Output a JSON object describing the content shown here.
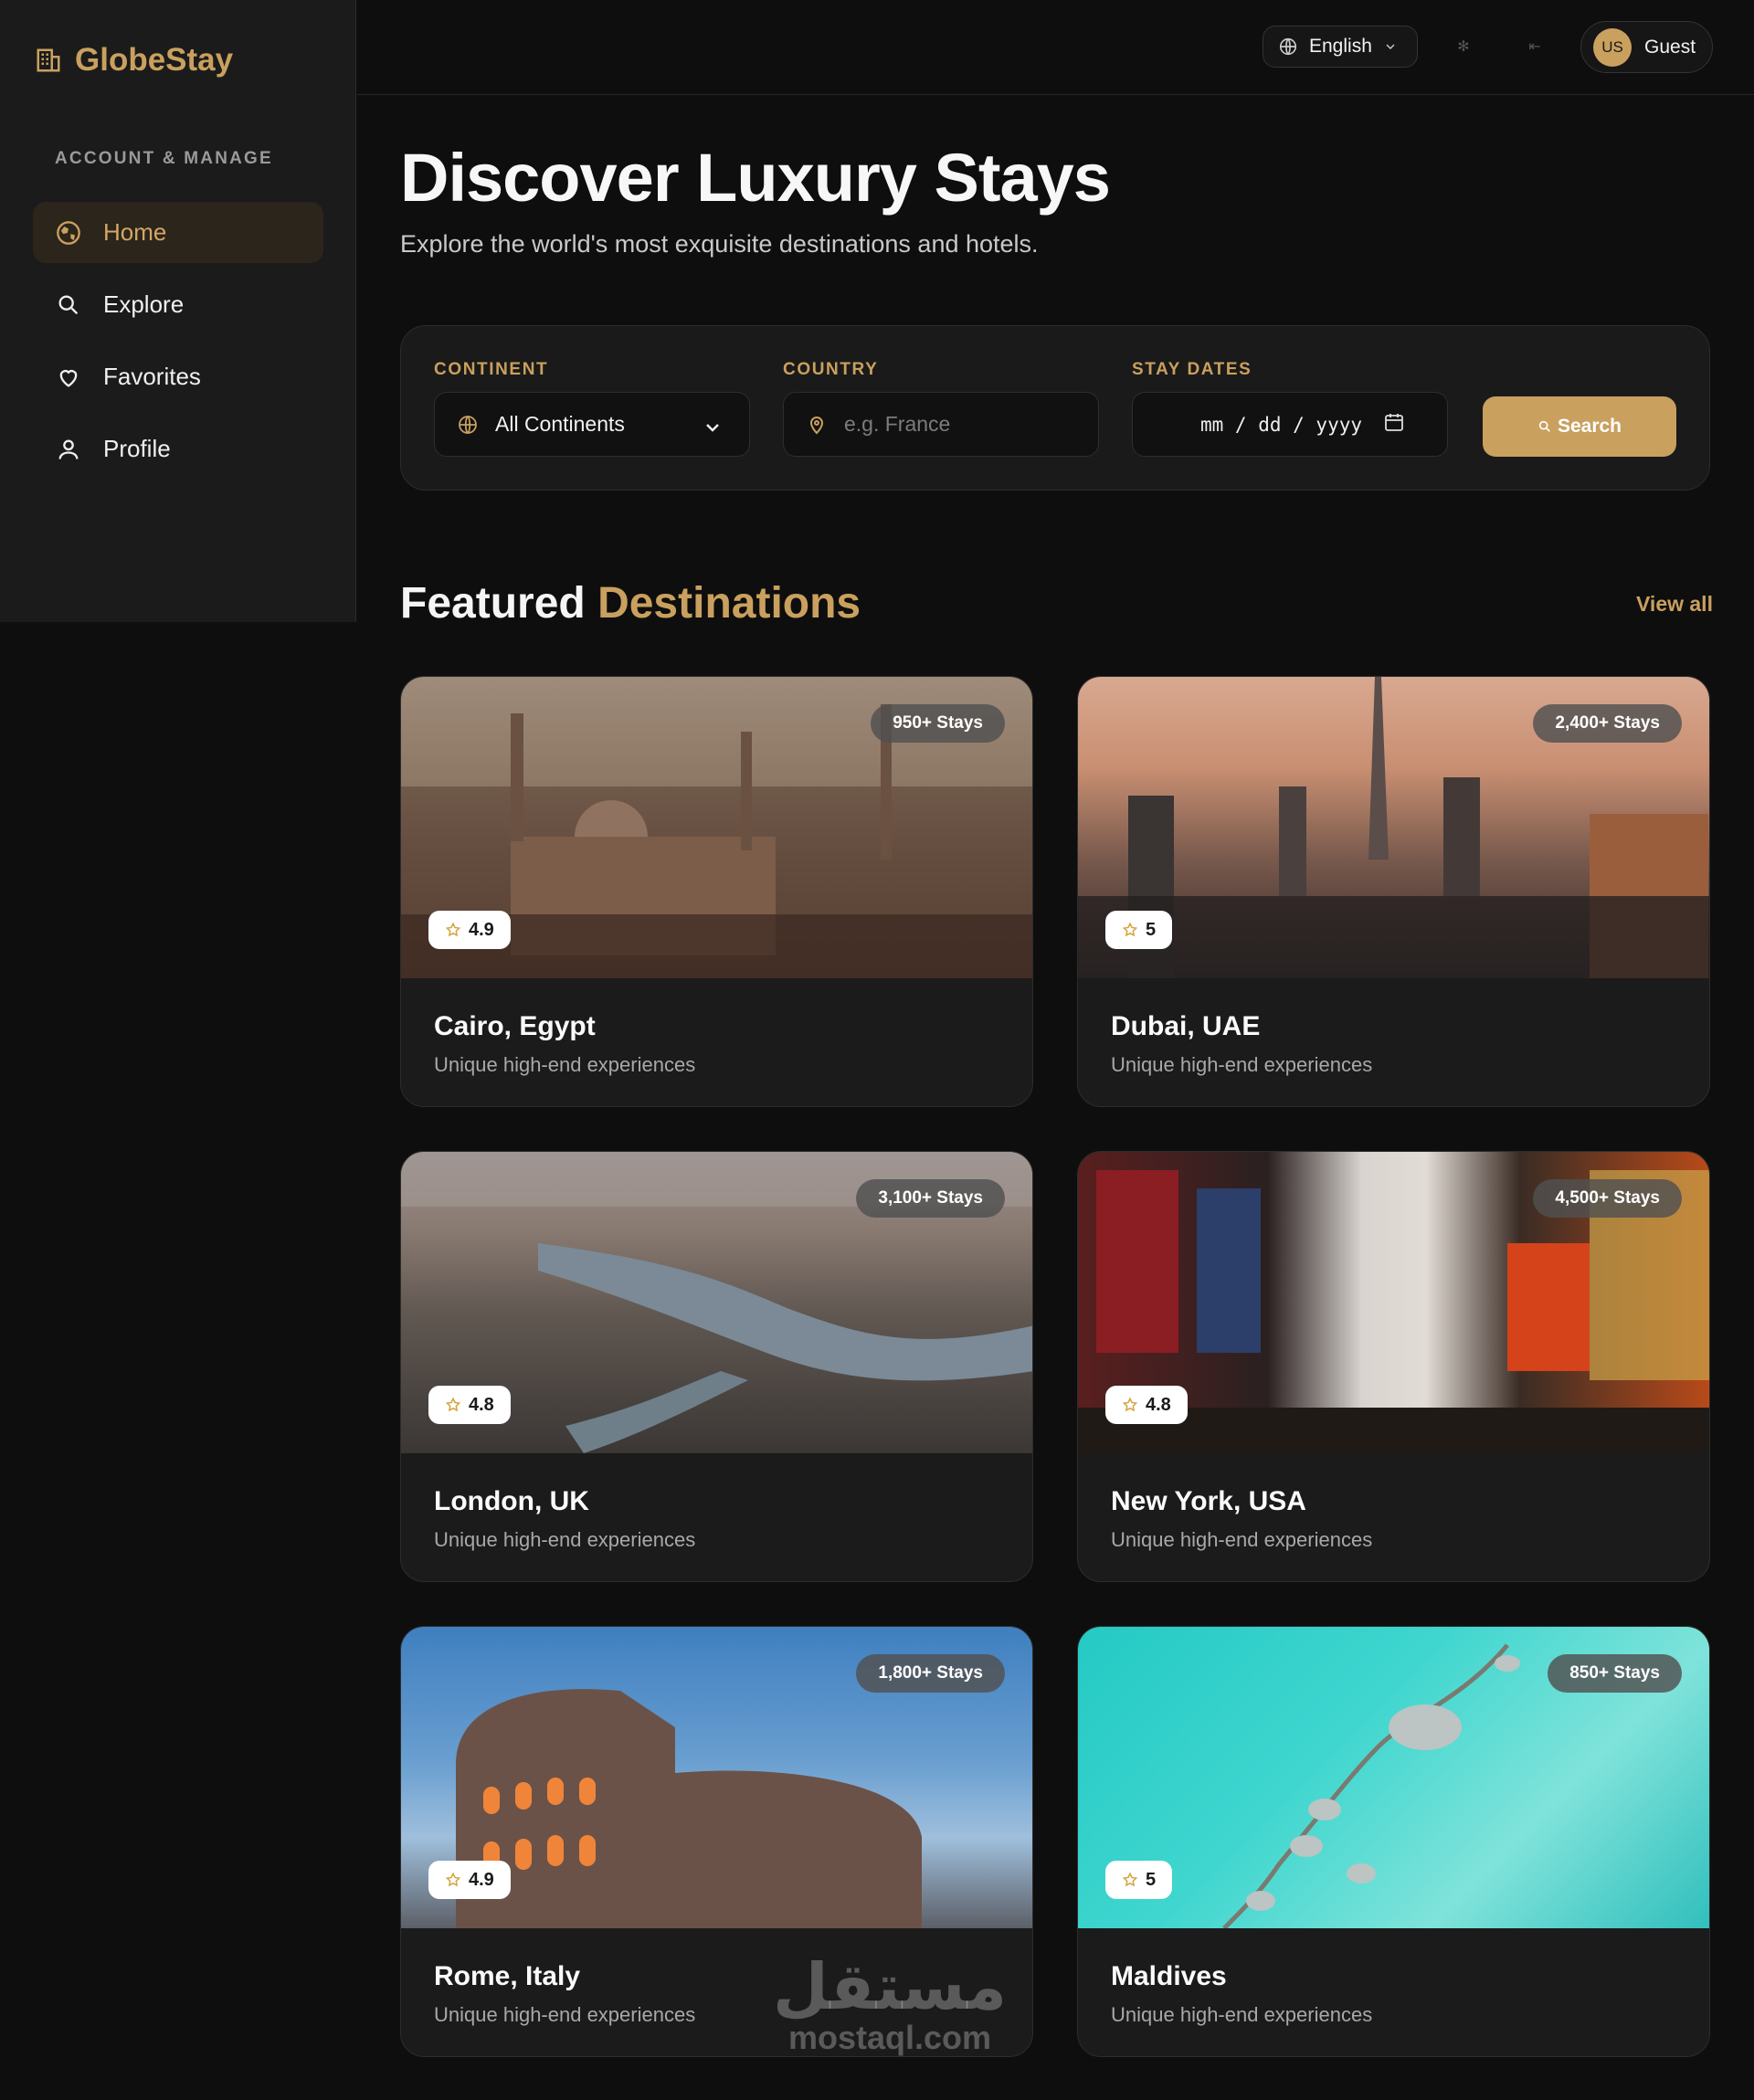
{
  "brand": {
    "name": "GlobeStay",
    "icon": "hotel-building-icon",
    "color": "#c9a05e"
  },
  "sidebar": {
    "section_label": "ACCOUNT & MANAGE",
    "items": [
      {
        "label": "Home",
        "icon": "globe-icon",
        "active": true
      },
      {
        "label": "Explore",
        "icon": "search-icon",
        "active": false
      },
      {
        "label": "Favorites",
        "icon": "heart-icon",
        "active": false
      },
      {
        "label": "Profile",
        "icon": "user-icon",
        "active": false
      }
    ]
  },
  "topbar": {
    "language": "English",
    "user_initials": "US",
    "user_name": "Guest"
  },
  "hero": {
    "title": "Discover Luxury Stays",
    "subtitle": "Explore the world's most exquisite destinations and hotels."
  },
  "search": {
    "continent_label": "CONTINENT",
    "continent_value": "All Continents",
    "country_label": "COUNTRY",
    "country_placeholder": "e.g. France",
    "dates_label": "STAY DATES",
    "dates_placeholder": "mm / dd / yyyy",
    "button_label": "Search"
  },
  "featured": {
    "title_part1": "Featured",
    "title_part2": "Destinations",
    "view_all": "View all",
    "cards": [
      {
        "title": "Cairo, Egypt",
        "desc": "Unique high-end experiences",
        "stays": "950+ Stays",
        "rating": "4.9"
      },
      {
        "title": "Dubai, UAE",
        "desc": "Unique high-end experiences",
        "stays": "2,400+ Stays",
        "rating": "5"
      },
      {
        "title": "London, UK",
        "desc": "Unique high-end experiences",
        "stays": "3,100+ Stays",
        "rating": "4.8"
      },
      {
        "title": "New York, USA",
        "desc": "Unique high-end experiences",
        "stays": "4,500+ Stays",
        "rating": "4.8"
      },
      {
        "title": "Rome, Italy",
        "desc": "Unique high-end experiences",
        "stays": "1,800+ Stays",
        "rating": "4.9"
      },
      {
        "title": "Maldives",
        "desc": "Unique high-end experiences",
        "stays": "850+ Stays",
        "rating": "5"
      }
    ]
  },
  "watermark": {
    "arabic": "مستقل",
    "latin": "mostaql.com"
  }
}
